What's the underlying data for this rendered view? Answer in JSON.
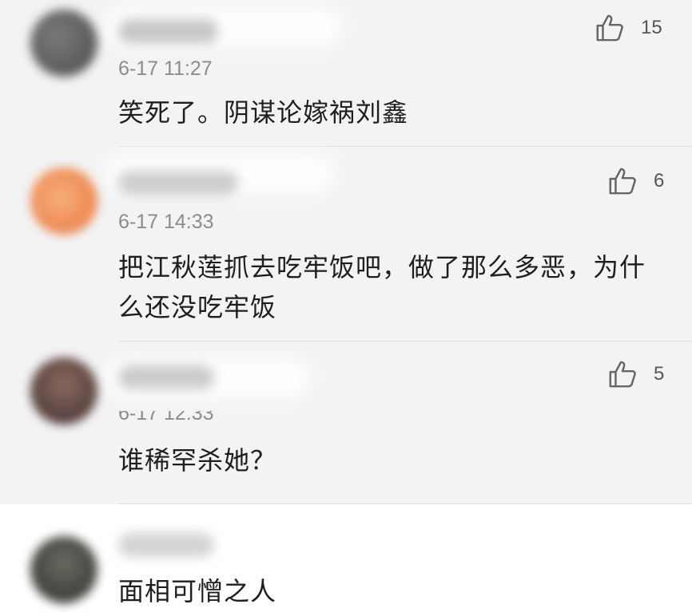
{
  "comments": [
    {
      "time": "6-17 11:27",
      "text": "笑死了。阴谋论嫁祸刘鑫",
      "likes": "15",
      "avatar_color": "#5a5a5a"
    },
    {
      "time": "6-17 14:33",
      "text": "把江秋莲抓去吃牢饭吧，做了那么多恶，为什么还没吃牢饭",
      "likes": "6",
      "avatar_color": "#f08a5a"
    },
    {
      "time": "6-17 12:33",
      "text": "谁稀罕杀她？",
      "likes": "5",
      "avatar_color": "#6b4a44"
    },
    {
      "text": "面相可憎之人",
      "avatar_color": "#4d4d47"
    }
  ],
  "icons": {
    "like": "thumbs-up-icon"
  },
  "colors": {
    "background": "#f3f3f3",
    "highlight_background": "#ffffff",
    "time_text": "#8c8c8c",
    "comment_text": "#1e1e1e"
  }
}
